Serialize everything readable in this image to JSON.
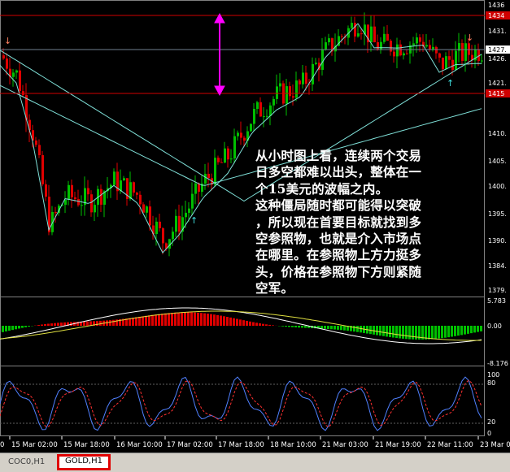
{
  "chart_data": {
    "type": "line",
    "instrument": "GOLD,H1",
    "price_axis_labels": [
      "1436",
      "1431.",
      "1427.",
      "1426.",
      "1421.",
      "1415",
      "1410.",
      "1405.",
      "1400.",
      "1395.",
      "1390.",
      "1384.",
      "1379."
    ],
    "highlighted_prices": {
      "top": "1434",
      "current": "1427.",
      "bottom": "1415"
    },
    "macd_axis_labels": [
      "5.783",
      "0.00",
      "-8.176"
    ],
    "stoch_axis_labels": [
      "100",
      "80",
      "20",
      "0"
    ],
    "x_tick_labels": [
      "0",
      "15 Mar 02:00",
      "15 Mar 18:00",
      "16 Mar 10:00",
      "17 Mar 02:00",
      "17 Mar 18:00",
      "18 Mar 10:00",
      "21 Mar 03:00",
      "21 Mar 19:00",
      "22 Mar 11:00",
      "23 Mar 0"
    ],
    "resistance_level": 1434,
    "support_level": 1415,
    "current_price": 1427,
    "price_ylim": [
      1378,
      1437
    ]
  },
  "annotation": {
    "lines": [
      "从小时图上看，连续两个交易",
      "日多空都难以出头，整体在一",
      "个15美元的波幅之内。",
      "这种僵局随时都可能得以突破",
      "，所以现在首要目标就找到多",
      "空参照物，也就是介入市场点",
      "在哪里。在参照物上方力挺多",
      "头，价格在参照物下方则紧随",
      "空军。"
    ]
  },
  "tabs": [
    {
      "label": "COC0,H1"
    },
    {
      "label": "GOLD,H1"
    }
  ],
  "colors": {
    "background": "#000000",
    "bull_candle": "#00c000",
    "bear_candle": "#e00000",
    "level_line": "#d00000",
    "arrow": "#ff00ff",
    "ma": "#7fe0d8",
    "axis_text": "#ffffff"
  }
}
